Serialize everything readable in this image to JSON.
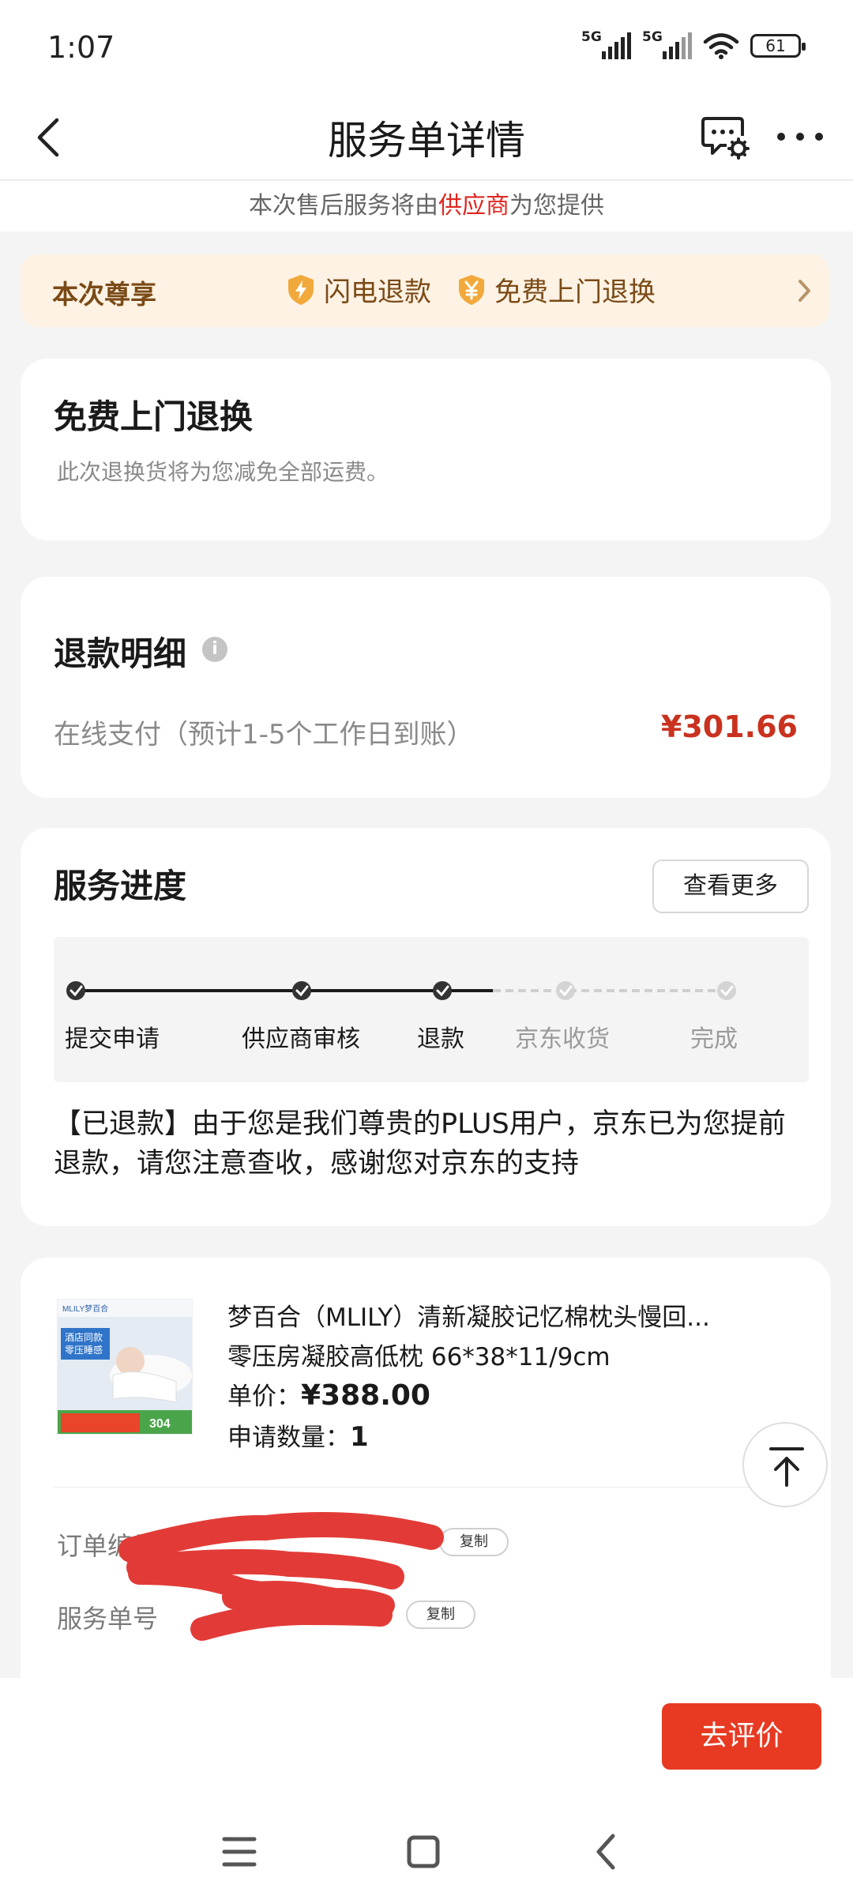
{
  "status_bar": {
    "time": "1:07",
    "network1": "5G",
    "network2": "5G",
    "battery": "61"
  },
  "nav": {
    "title": "服务单详情"
  },
  "provider": {
    "prefix": "本次售后服务将由",
    "highlight": "供应商",
    "suffix": "为您提供"
  },
  "privilege": {
    "label": "本次尊享",
    "items": [
      "闪电退款",
      "免费上门退换"
    ]
  },
  "free_pickup": {
    "title": "免费上门退换",
    "desc": "此次退换货将为您减免全部运费。"
  },
  "refund": {
    "title": "退款明细",
    "info_icon": "i",
    "method": "在线支付（预计1-5个工作日到账）",
    "amount": "¥301.66"
  },
  "progress": {
    "title": "服务进度",
    "more_label": "查看更多",
    "steps": [
      "提交申请",
      "供应商审核",
      "退款",
      "京东收货",
      "完成"
    ],
    "completed_steps": 3,
    "status_text": "【已退款】由于您是我们尊贵的PLUS用户，京东已为您提前退款，请您注意查收，感谢您对京东的支持"
  },
  "product": {
    "name": "梦百合（MLILY）清新凝胶记忆棉枕头慢回...",
    "spec": "零压房凝胶高低枕 66*38*11/9cm",
    "price_label": "单价：",
    "price": "¥388.00",
    "qty_label": "申请数量：",
    "qty": "1",
    "img_text": {
      "brand": "MLILY梦百合",
      "line1": "酒店同款",
      "line2": "零压睡感",
      "badge": "304"
    }
  },
  "details": {
    "order_no_label": "订单编号",
    "service_no_label": "服务单号",
    "copy_label": "复制"
  },
  "bottom": {
    "evaluate_label": "去评价"
  },
  "colors": {
    "accent": "#e83a22",
    "price_red": "#c9321f",
    "privilege_bg": "#fdf2e3",
    "privilege_text": "#7a4a16"
  }
}
